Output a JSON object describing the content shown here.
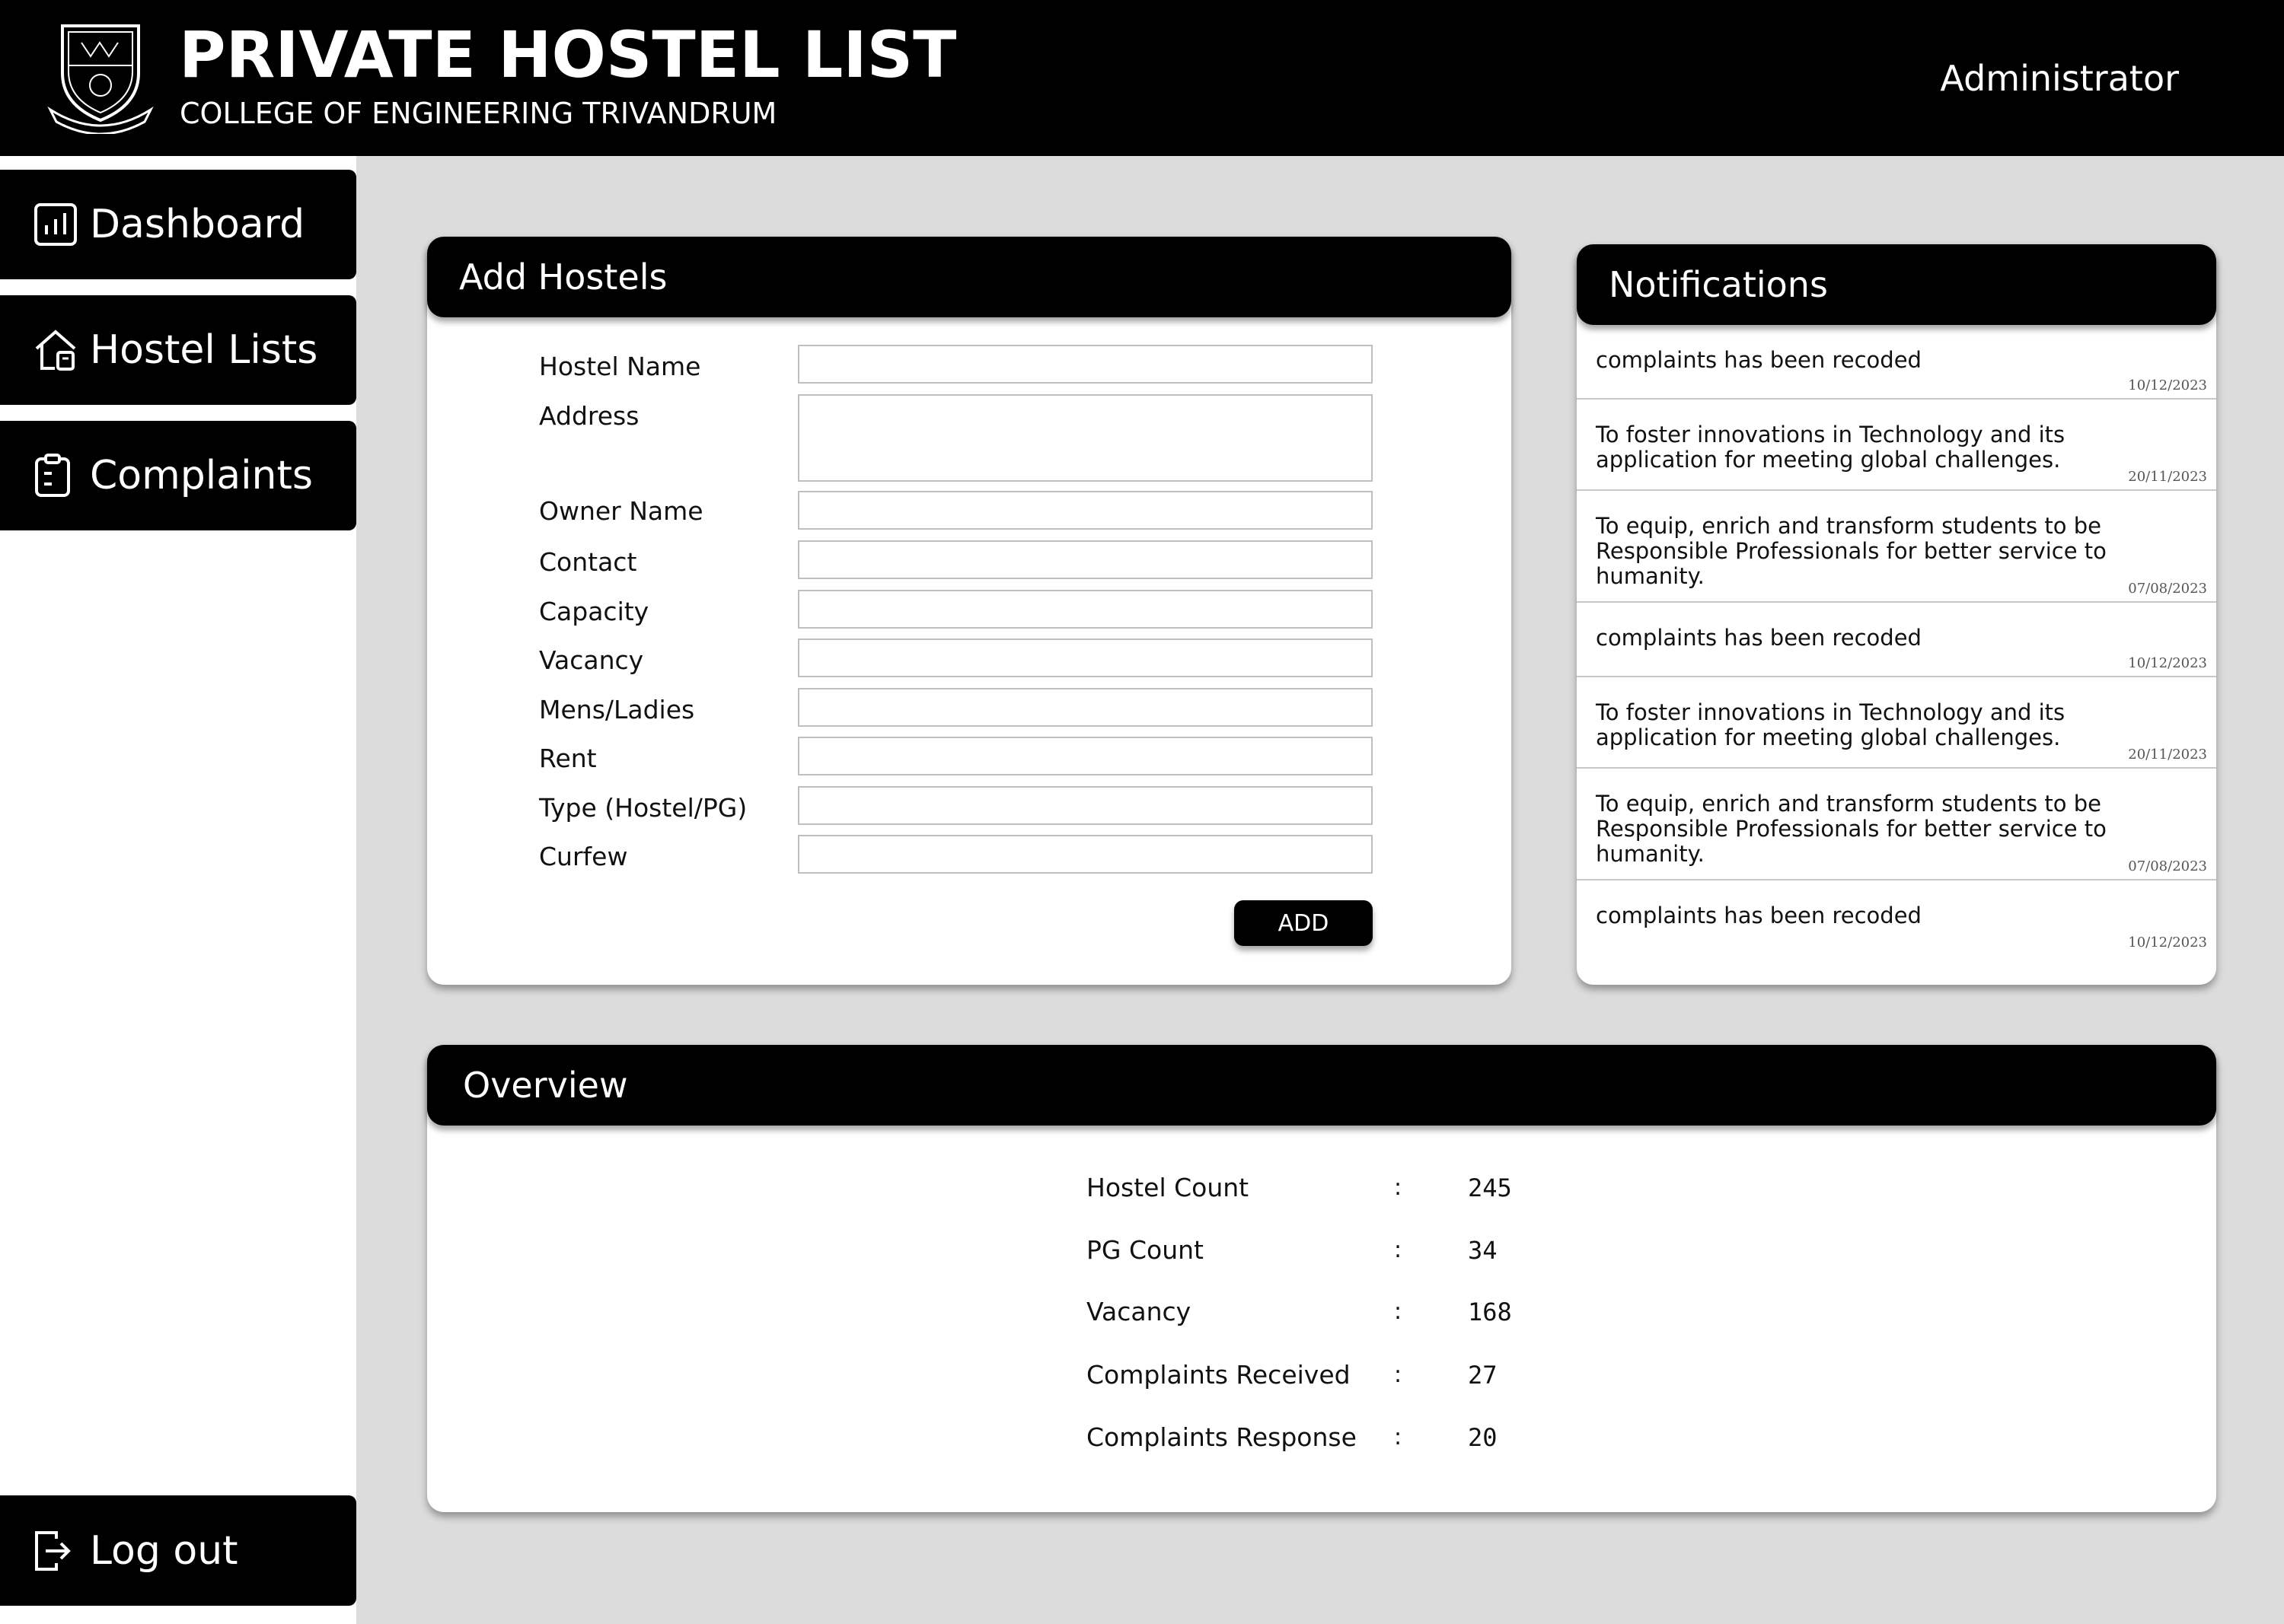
{
  "header": {
    "title": "PRIVATE HOSTEL LIST",
    "subtitle": "COLLEGE OF ENGINEERING TRIVANDRUM",
    "user_role": "Administrator"
  },
  "sidebar": {
    "items": [
      {
        "label": "Dashboard",
        "icon": "bar-chart-icon"
      },
      {
        "label": "Hostel Lists",
        "icon": "house-icon"
      },
      {
        "label": "Complaints",
        "icon": "clipboard-icon"
      }
    ],
    "logout": {
      "label": "Log out",
      "icon": "logout-icon"
    }
  },
  "add_hostels": {
    "title": "Add Hostels",
    "fields": [
      {
        "label": "Hostel Name",
        "value": ""
      },
      {
        "label": "Address",
        "value": ""
      },
      {
        "label": "Owner Name",
        "value": ""
      },
      {
        "label": "Contact",
        "value": ""
      },
      {
        "label": "Capacity",
        "value": ""
      },
      {
        "label": "Vacancy",
        "value": ""
      },
      {
        "label": "Mens/Ladies",
        "value": ""
      },
      {
        "label": "Rent",
        "value": ""
      },
      {
        "label": "Type (Hostel/PG)",
        "value": ""
      },
      {
        "label": "Curfew",
        "value": ""
      }
    ],
    "button_label": "ADD"
  },
  "notifications": {
    "title": "Notifications",
    "items": [
      {
        "text": "complaints has been recoded",
        "date": "10/12/2023"
      },
      {
        "text": "To foster innovations in Technology and its application for meeting global challenges.",
        "date": "20/11/2023"
      },
      {
        "text": "To equip, enrich and transform students to be Responsible Professionals for better service to humanity.",
        "date": "07/08/2023"
      },
      {
        "text": "complaints has been recoded",
        "date": "10/12/2023"
      },
      {
        "text": "To foster innovations in Technology and its application for meeting global challenges.",
        "date": "20/11/2023"
      },
      {
        "text": "To equip, enrich and transform students to be Responsible Professionals for better service to humanity.",
        "date": "07/08/2023"
      },
      {
        "text": "complaints has been recoded",
        "date": "10/12/2023"
      }
    ]
  },
  "overview": {
    "title": "Overview",
    "separator": ":",
    "rows": [
      {
        "label": "Hostel Count",
        "value": "245"
      },
      {
        "label": "PG Count",
        "value": "34"
      },
      {
        "label": "Vacancy",
        "value": "168"
      },
      {
        "label": "Complaints Received",
        "value": "27"
      },
      {
        "label": "Complaints Response",
        "value": "20"
      }
    ]
  }
}
